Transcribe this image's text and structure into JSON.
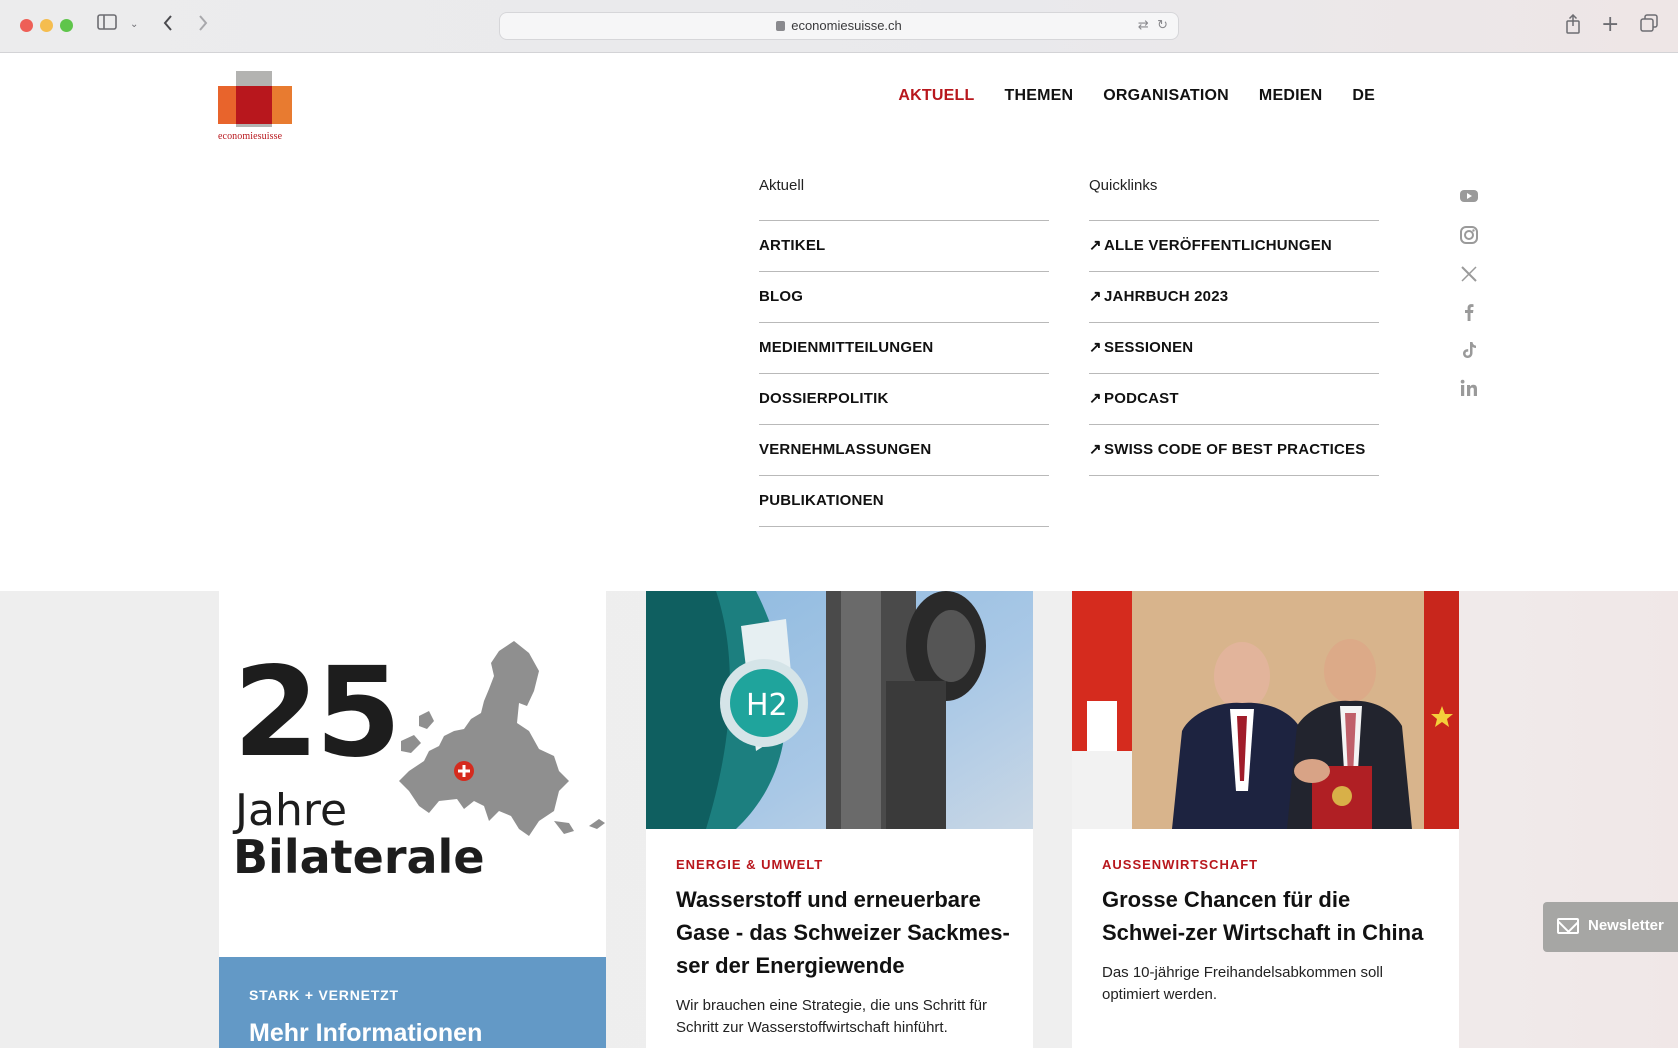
{
  "browser": {
    "url": "economiesuisse.ch",
    "sidebar_icon": "sidebar-icon",
    "back_icon": "chevron-left-icon",
    "forward_icon": "chevron-right-icon",
    "share_icon": "share-icon",
    "new_tab_icon": "plus-icon",
    "tabs_icon": "tabs-overview-icon",
    "translate_icon": "translate-icon",
    "reload_icon": "reload-icon"
  },
  "logo": {
    "wordmark": "economiesuisse"
  },
  "nav": {
    "items": [
      "AKTUELL",
      "THEMEN",
      "ORGANISATION",
      "MEDIEN",
      "DE"
    ],
    "active": "AKTUELL"
  },
  "menu": {
    "aktuell": {
      "heading": "Aktuell",
      "items": [
        "ARTIKEL",
        "BLOG",
        "MEDIENMITTEILUNGEN",
        "DOSSIERPOLITIK",
        "VERNEHMLASSUNGEN",
        "PUBLIKATIONEN"
      ]
    },
    "quicklinks": {
      "heading": "Quicklinks",
      "items": [
        "ALLE VERÖFFENTLICHUNGEN",
        "JAHRBUCH 2023",
        "SESSIONEN",
        "PODCAST",
        "SWISS CODE OF BEST PRACTICES"
      ]
    }
  },
  "social": [
    "youtube-icon",
    "instagram-icon",
    "x-icon",
    "facebook-icon",
    "tiktok-icon",
    "linkedin-icon"
  ],
  "cards": {
    "bilaterale": {
      "num": "25",
      "jahre": "Jahre",
      "bilaterale": "Bilaterale",
      "tag": "STARK + VERNETZT",
      "title": "Mehr Informationen"
    },
    "wasserstoff": {
      "image_label": "H2",
      "tag": "ENERGIE & UMWELT",
      "title": "Wasserstoff und erneuerbare Gase - das Schweizer Sackmes-ser der Energiewende",
      "teaser": "Wir brauchen eine Strategie, die uns Schritt für Schritt zur Wasserstoffwirtschaft hinführt."
    },
    "china": {
      "tag": "AUSSENWIRTSCHAFT",
      "title": "Grosse Chancen für die Schwei-zer Wirtschaft in China",
      "teaser": "Das 10-jährige Freihandelsabkommen soll optimiert werden."
    }
  },
  "newsletter": {
    "label": "Newsletter"
  },
  "colors": {
    "brand_red": "#b8171d",
    "accent_blue": "#6399c6"
  }
}
